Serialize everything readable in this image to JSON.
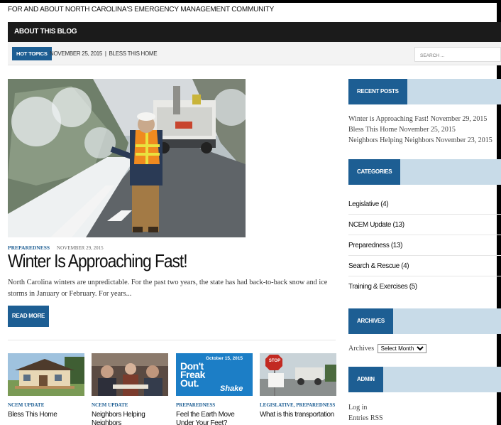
{
  "header": {
    "tagline": "FOR AND ABOUT NORTH CAROLINA'S EMERGENCY MANAGEMENT COMMUNITY"
  },
  "nav": {
    "items": [
      {
        "label": "ABOUT THIS BLOG"
      }
    ]
  },
  "subbar": {
    "hot_topics_label": "HOT TOPICS",
    "ticker_text": "NOVEMBER 25, 2015  |  BLESS THIS HOME",
    "search_placeholder": "SEARCH ..."
  },
  "featured": {
    "category": "PREPAREDNESS",
    "date": "NOVEMBER 29, 2015",
    "title": "Winter Is Approaching Fast!",
    "excerpt": "North Carolina winters are unpredictable. For the past two years, the state has had back-to-back snow and ice storms in January or February. For years...",
    "read_more_label": "READ MORE"
  },
  "cards": [
    {
      "category": "NCEM UPDATE",
      "title": "Bless This Home"
    },
    {
      "category": "NCEM UPDATE",
      "title": "Neighbors Helping Neighbors"
    },
    {
      "category": "PREPAREDNESS",
      "title": "Feel the Earth Move Under Your Feet? ShakeOut, Don't",
      "thumb_lines": [
        "October 15, 2015",
        "Don't",
        "Freak",
        "Out.",
        "Shake"
      ]
    },
    {
      "category": "LEGISLATIVE, PREPAREDNESS",
      "title": "What is this transportation",
      "thumb_sign": "STOP"
    }
  ],
  "sidebar": {
    "recent_posts": {
      "heading": "RECENT POSTS",
      "items": [
        {
          "title": "Winter is Approaching Fast!",
          "date": "November 29, 2015"
        },
        {
          "title": "Bless This Home",
          "date": "November 25, 2015"
        },
        {
          "title": "Neighbors Helping Neighbors",
          "date": "November 23, 2015"
        }
      ]
    },
    "categories": {
      "heading": "CATEGORIES",
      "items": [
        {
          "label": "Legislative (4)"
        },
        {
          "label": "NCEM Update (13)"
        },
        {
          "label": "Preparedness (13)"
        },
        {
          "label": "Search & Rescue (4)"
        },
        {
          "label": "Training & Exercises (5)"
        }
      ]
    },
    "archives": {
      "heading": "ARCHIVES",
      "label": "Archives",
      "select_value": "Select Month"
    },
    "admin": {
      "heading": "ADMIN",
      "links": [
        {
          "label": "Log in"
        },
        {
          "label": "Entries RSS"
        }
      ]
    }
  },
  "colors": {
    "accent_blue": "#1d5e93",
    "widget_band": "#c8dbe8",
    "navbar": "#1b1b1b"
  }
}
